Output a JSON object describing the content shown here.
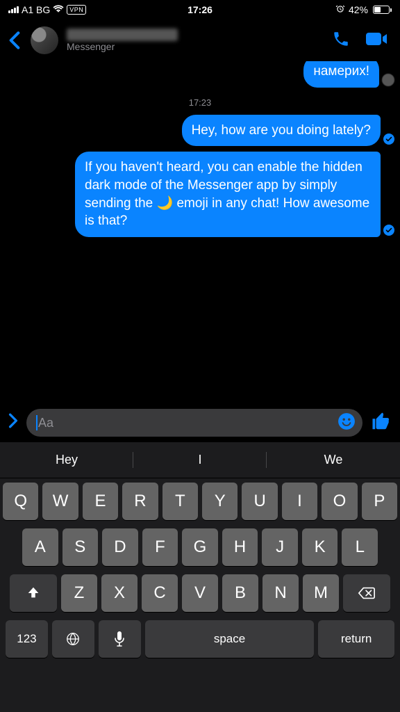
{
  "status": {
    "carrier": "A1 BG",
    "vpn": "VPN",
    "time": "17:26",
    "battery_pct": "42%"
  },
  "header": {
    "subtitle": "Messenger"
  },
  "chat": {
    "timestamp": "17:23",
    "messages": [
      {
        "text": "намерих!"
      },
      {
        "text": "Hey, how are you doing lately?"
      },
      {
        "text": "If you haven't heard, you can enable the hidden dark mode of the Messenger app by simply sending the 🌙 emoji in any chat! How awesome is that?"
      }
    ]
  },
  "composer": {
    "placeholder": "Aa"
  },
  "keyboard": {
    "suggestions": [
      "Hey",
      "I",
      "We"
    ],
    "row1": [
      "Q",
      "W",
      "E",
      "R",
      "T",
      "Y",
      "U",
      "I",
      "O",
      "P"
    ],
    "row2": [
      "A",
      "S",
      "D",
      "F",
      "G",
      "H",
      "J",
      "K",
      "L"
    ],
    "row3": [
      "Z",
      "X",
      "C",
      "V",
      "B",
      "N",
      "M"
    ],
    "numkey": "123",
    "space": "space",
    "return": "return"
  }
}
